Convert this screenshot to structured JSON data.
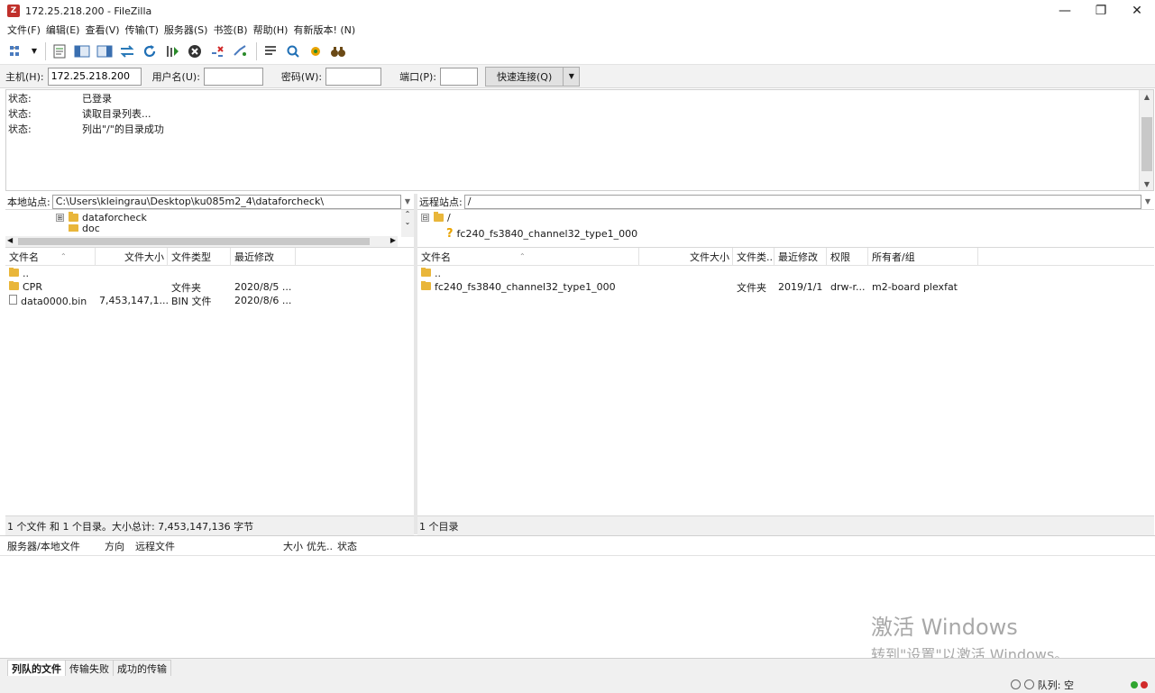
{
  "window": {
    "app_icon": "Z",
    "title": "172.25.218.200 - FileZilla",
    "minimize": "—",
    "restore": "❐",
    "close": "✕"
  },
  "menu": [
    "文件(F)",
    "编辑(E)",
    "查看(V)",
    "传输(T)",
    "服务器(S)",
    "书签(B)",
    "帮助(H)",
    "有新版本! (N)"
  ],
  "toolbar_icons": [
    "site-manager-icon",
    "dropdown-icon",
    "toggle-log-icon",
    "toggle-local-tree-icon",
    "toggle-remote-tree-icon",
    "toggle-queue-icon",
    "refresh-icon",
    "process-queue-icon",
    "cancel-icon",
    "disconnect-icon",
    "reconnect-icon",
    "filter-icon",
    "compare-icon",
    "sync-browse-icon",
    "search-icon"
  ],
  "quickconnect": {
    "host_label": "主机(H):",
    "host_value": "172.25.218.200",
    "user_label": "用户名(U):",
    "user_value": "",
    "pass_label": "密码(W):",
    "pass_value": "",
    "port_label": "端口(P):",
    "port_value": "",
    "connect_label": "快速连接(Q)",
    "dropdown": "▼"
  },
  "log": [
    {
      "key": "状态:",
      "value": "已登录"
    },
    {
      "key": "状态:",
      "value": "读取目录列表..."
    },
    {
      "key": "状态:",
      "value": "列出\"/\"的目录成功"
    }
  ],
  "local": {
    "site_label": "本地站点:",
    "path": "C:\\Users\\kleingrau\\Desktop\\ku085m2_4\\dataforcheck\\",
    "tree": [
      {
        "expander": "⊞",
        "name": "dataforcheck"
      },
      {
        "expander": "",
        "name": "doc"
      }
    ],
    "columns": {
      "name": "文件名",
      "size": "文件大小",
      "type": "文件类型",
      "modified": "最近修改"
    },
    "files": [
      {
        "name": "..",
        "size": "",
        "type": "",
        "modified": "",
        "kind": "folder"
      },
      {
        "name": "CPR",
        "size": "",
        "type": "文件夹",
        "modified": "2020/8/5 ...",
        "kind": "folder"
      },
      {
        "name": "data0000.bin",
        "size": "7,453,147,1...",
        "type": "BIN 文件",
        "modified": "2020/8/6 ...",
        "kind": "file"
      }
    ],
    "status": "1 个文件 和 1 个目录。大小总计: 7,453,147,136 字节"
  },
  "remote": {
    "site_label": "远程站点:",
    "path": "/",
    "tree": [
      {
        "expander": "⊟",
        "name": "/"
      },
      {
        "expander": "",
        "name": "fc240_fs3840_channel32_type1_000"
      }
    ],
    "columns": {
      "name": "文件名",
      "size": "文件大小",
      "type": "文件类...",
      "modified": "最近修改",
      "perm": "权限",
      "owner": "所有者/组"
    },
    "files": [
      {
        "name": "..",
        "size": "",
        "type": "",
        "modified": "",
        "perm": "",
        "owner": ""
      },
      {
        "name": "fc240_fs3840_channel32_type1_000",
        "size": "",
        "type": "文件夹",
        "modified": "2019/1/1",
        "perm": "drw-r...",
        "owner": "m2-board plexfat"
      }
    ],
    "status": "1 个目录"
  },
  "queue": {
    "columns": {
      "server": "服务器/本地文件",
      "direction": "方向",
      "remote": "远程文件",
      "size": "大小",
      "priority": "优先...",
      "status": "状态"
    }
  },
  "tabs": [
    "列队的文件",
    "传输失败",
    "成功的传输"
  ],
  "statusbar": {
    "queue": "队列: 空"
  },
  "activation": {
    "title": "激活 Windows",
    "subtitle": "转到\"设置\"以激活 Windows。"
  },
  "colors": {
    "folder": "#e9b63a",
    "led_green": "#2fa52f",
    "led_red": "#d12a2a",
    "app_icon": "#c0302b"
  }
}
